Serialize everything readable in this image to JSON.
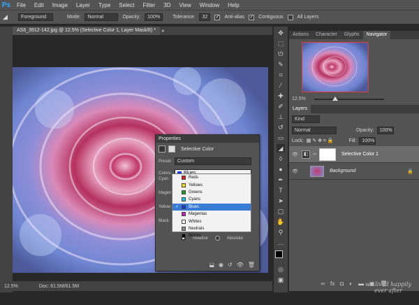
{
  "menu": {
    "logo": "Ps",
    "items": [
      "File",
      "Edit",
      "Image",
      "Layer",
      "Type",
      "Select",
      "Filter",
      "3D",
      "View",
      "Window",
      "Help"
    ]
  },
  "options": {
    "tool_preset": "Foreground",
    "mode_label": "Mode:",
    "mode_value": "Normal",
    "opacity_label": "Opacity:",
    "opacity_value": "100%",
    "tolerance_label": "Tolerance:",
    "tolerance_value": "32",
    "anti_alias": "Anti-alias",
    "contiguous": "Contiguous",
    "all_layers": "All Layers"
  },
  "document": {
    "tab_title": "AS6_3912-142.jpg @ 12.5% (Selective Color 1, Layer Mask/8) *",
    "zoom": "12.5%",
    "doc_size": "Doc: 61.5M/61.5M"
  },
  "navigator": {
    "tabs": [
      "Actions",
      "Character",
      "Glyphs",
      "Navigator"
    ],
    "zoom": "12.5%"
  },
  "layers": {
    "title": "Layers",
    "filter_kind": "Kind",
    "blend_mode": "Normal",
    "opacity_label": "Opacity:",
    "opacity_value": "100%",
    "lock_label": "Lock:",
    "fill_label": "Fill:",
    "fill_value": "100%",
    "rows": [
      {
        "name": "Selective Color 1"
      },
      {
        "name": "Background"
      }
    ]
  },
  "properties": {
    "title": "Properties",
    "adjustment_name": "Selective Color",
    "preset_label": "Preset:",
    "preset_value": "Custom",
    "colors_label": "Colors:",
    "colors_value": "Blues",
    "partial_labels": [
      "Cyan",
      "Magen",
      "Yellow",
      "Black"
    ],
    "relative": "Relative",
    "absolute": "Absolute",
    "color_options": [
      {
        "name": "Reds",
        "color": "#e01b1b"
      },
      {
        "name": "Yellows",
        "color": "#f4e200"
      },
      {
        "name": "Greens",
        "color": "#1da01d"
      },
      {
        "name": "Cyans",
        "color": "#18c6f0"
      },
      {
        "name": "Blues",
        "color": "#1735e0"
      },
      {
        "name": "Magentas",
        "color": "#c81cc8"
      },
      {
        "name": "Whites",
        "color": "#ffffff"
      },
      {
        "name": "Neutrals",
        "color": "#8c8c8c"
      },
      {
        "name": "Blacks",
        "color": "#000000"
      }
    ],
    "selected_index": 4
  },
  "watermark": {
    "line1": "we lived happily",
    "line2": "ever after"
  },
  "colors": {
    "accent": "#31a8ff",
    "selection": "#3a7bd5"
  }
}
